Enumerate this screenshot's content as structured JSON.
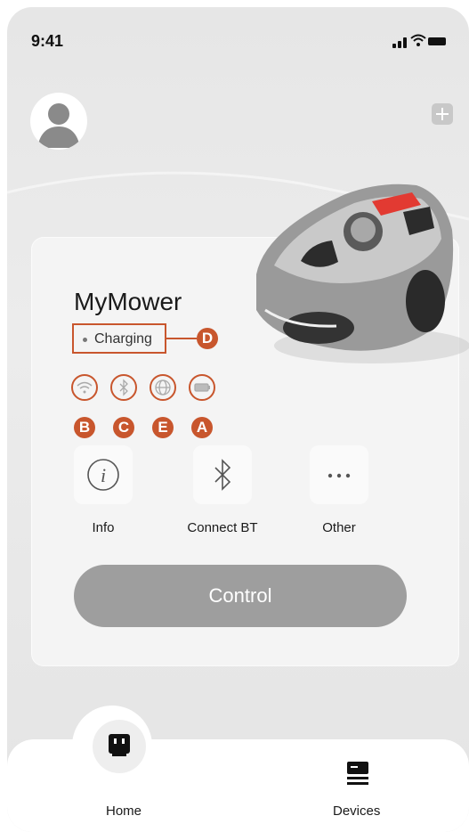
{
  "status_bar": {
    "time": "9:41"
  },
  "device": {
    "name": "MyMower",
    "status": "Charging"
  },
  "callouts": {
    "a": "A",
    "b": "B",
    "c": "C",
    "d": "D",
    "e": "E"
  },
  "actions": [
    {
      "label": "Info",
      "icon": "info-icon"
    },
    {
      "label": "Connect BT",
      "icon": "bluetooth-icon"
    },
    {
      "label": "Other",
      "icon": "more-icon"
    }
  ],
  "control": {
    "label": "Control"
  },
  "tabs": [
    {
      "label": "Home",
      "icon": "home-device-icon",
      "active": true
    },
    {
      "label": "Devices",
      "icon": "devices-icon",
      "active": false
    }
  ],
  "colors": {
    "accent": "#c8562d",
    "control": "#9e9e9e"
  }
}
